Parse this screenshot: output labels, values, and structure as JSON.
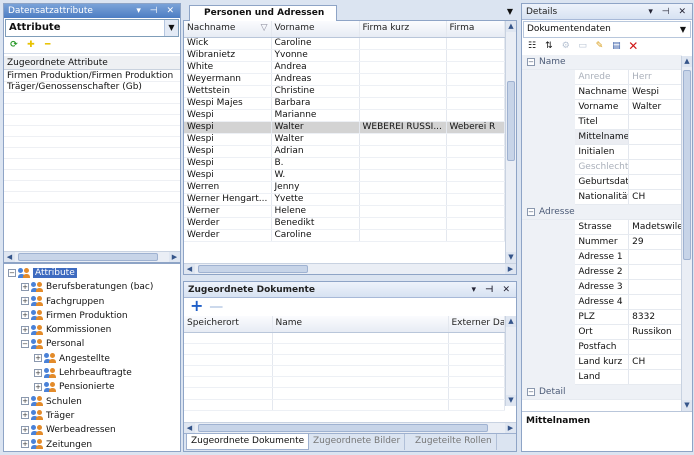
{
  "left_panel": {
    "title": "Datensatzattribute",
    "dropdown_value": "Attribute",
    "list_header": "Zugeordnete Attribute",
    "list_items": [
      "Firmen Produktion/Firmen Produktion",
      "Träger/Genossenschafter (Gb)"
    ]
  },
  "tree": {
    "root": "Attribute",
    "items": [
      {
        "label": "Berufsberatungen (bac)",
        "level": 1,
        "sign": "+"
      },
      {
        "label": "Fachgruppen",
        "level": 1,
        "sign": "+"
      },
      {
        "label": "Firmen Produktion",
        "level": 1,
        "sign": "+"
      },
      {
        "label": "Kommissionen",
        "level": 1,
        "sign": "+"
      },
      {
        "label": "Personal",
        "level": 1,
        "sign": "−"
      },
      {
        "label": "Angestellte",
        "level": 2,
        "sign": "+"
      },
      {
        "label": "Lehrbeauftragte",
        "level": 2,
        "sign": "+"
      },
      {
        "label": "Pensionierte",
        "level": 2,
        "sign": "+"
      },
      {
        "label": "Schulen",
        "level": 1,
        "sign": "+"
      },
      {
        "label": "Träger",
        "level": 1,
        "sign": "+"
      },
      {
        "label": "Werbeadressen",
        "level": 1,
        "sign": "+"
      },
      {
        "label": "Zeitungen",
        "level": 1,
        "sign": "+"
      }
    ]
  },
  "main": {
    "tab_label": "Personen und Adressen",
    "columns": [
      "Nachname",
      "Vorname",
      "Firma kurz",
      "Firma"
    ],
    "rows": [
      [
        "Wick",
        "Caroline",
        "",
        ""
      ],
      [
        "Wibranietz",
        "Yvonne",
        "",
        ""
      ],
      [
        "White",
        "Andrea",
        "",
        ""
      ],
      [
        "Weyermann",
        "Andreas",
        "",
        ""
      ],
      [
        "Wettstein",
        "Christine",
        "",
        ""
      ],
      [
        "Wespi Majes",
        "Barbara",
        "",
        ""
      ],
      [
        "Wespi",
        "Marianne",
        "",
        ""
      ],
      [
        "Wespi",
        "Walter",
        "WEBEREI RUSSI...",
        "Weberei R"
      ],
      [
        "Wespi",
        "Walter",
        "",
        ""
      ],
      [
        "Wespi",
        "Adrian",
        "",
        ""
      ],
      [
        "Wespi",
        "B.",
        "",
        ""
      ],
      [
        "Wespi",
        "W.",
        "",
        ""
      ],
      [
        "Werren",
        "Jenny",
        "",
        ""
      ],
      [
        "Werner Hengart...",
        "Yvette",
        "",
        ""
      ],
      [
        "Werner",
        "Helene",
        "",
        ""
      ],
      [
        "Werder",
        "Benedikt",
        "",
        ""
      ],
      [
        "Werder",
        "Caroline",
        "",
        ""
      ]
    ],
    "selected_row": 7
  },
  "documents": {
    "title": "Zugeordnete Dokumente",
    "columns": [
      "Speicherort",
      "Name",
      "Externer Date"
    ],
    "bottom_tabs": [
      "Zugeordnete Dokumente",
      "Zugeordnete Bilder",
      "Zugeteilte Rollen"
    ]
  },
  "details": {
    "title": "Details",
    "dropdown_value": "Dokumentendaten",
    "categories": [
      {
        "name": "Name",
        "props": [
          {
            "k": "Anrede",
            "v": "Herr",
            "disabled": true
          },
          {
            "k": "Nachname",
            "v": "Wespi"
          },
          {
            "k": "Vorname",
            "v": "Walter"
          },
          {
            "k": "Titel",
            "v": ""
          },
          {
            "k": "Mittelnamen",
            "v": "",
            "highlight": true
          },
          {
            "k": "Initialen",
            "v": ""
          },
          {
            "k": "Geschlecht",
            "v": "",
            "disabled": true
          },
          {
            "k": "Geburtsdatum",
            "v": ""
          },
          {
            "k": "Nationalität",
            "v": "CH"
          }
        ]
      },
      {
        "name": "Adresse",
        "props": [
          {
            "k": "Strasse",
            "v": "Madetswiler..."
          },
          {
            "k": "Nummer",
            "v": "29"
          },
          {
            "k": "Adresse 1",
            "v": ""
          },
          {
            "k": "Adresse 2",
            "v": ""
          },
          {
            "k": "Adresse 3",
            "v": ""
          },
          {
            "k": "Adresse 4",
            "v": ""
          },
          {
            "k": "PLZ",
            "v": "8332"
          },
          {
            "k": "Ort",
            "v": "Russikon"
          },
          {
            "k": "Postfach",
            "v": ""
          },
          {
            "k": "Land kurz",
            "v": "CH"
          },
          {
            "k": "Land",
            "v": ""
          }
        ]
      },
      {
        "name": "Detail",
        "props": []
      }
    ],
    "description_title": "Mittelnamen"
  },
  "colors": {
    "titlebar": "#4c7dc3",
    "selection": "#d3d3d3",
    "delete_red": "#d01818",
    "add_blue": "#1f5fc8"
  }
}
